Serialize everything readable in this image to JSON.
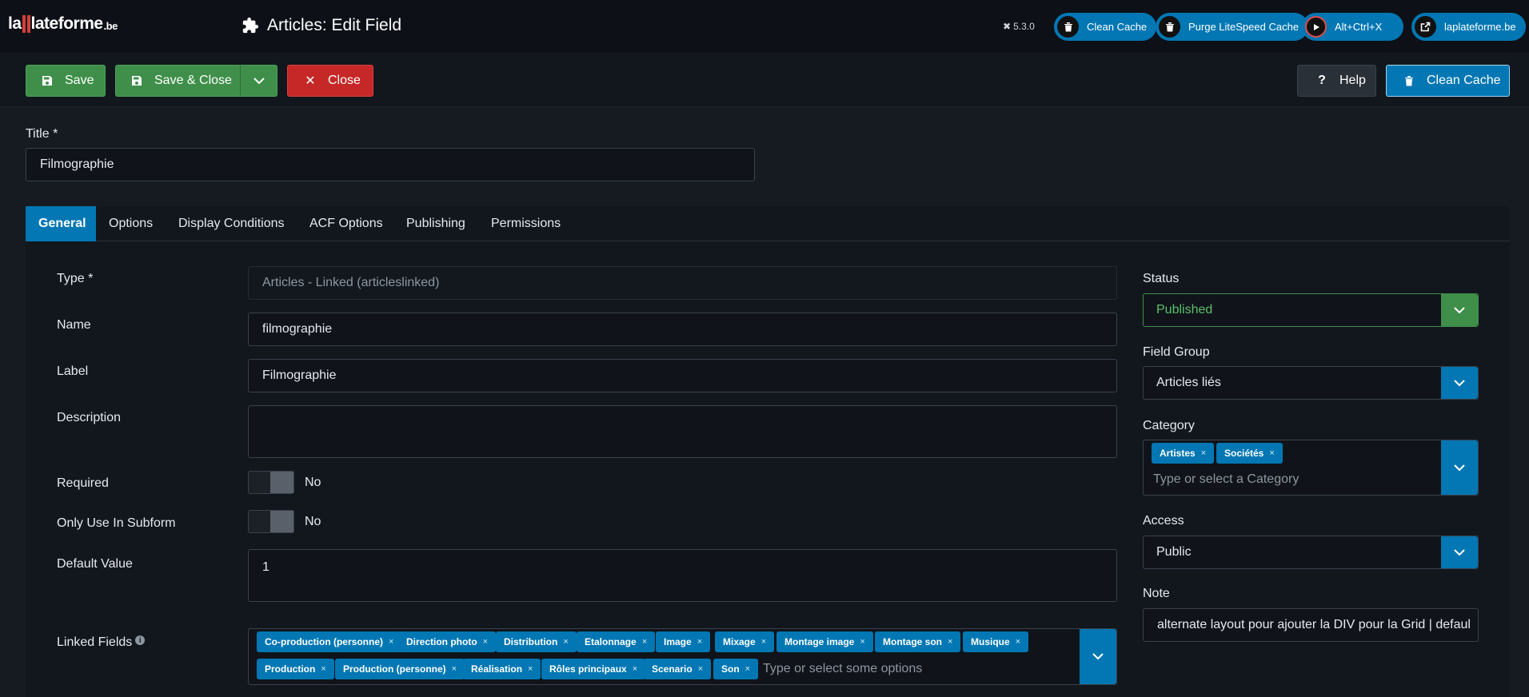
{
  "header": {
    "logo": {
      "la": "la",
      "word": "lateforme",
      "tld": ".be"
    },
    "page_title": "Articles: Edit Field",
    "version": "5.3.0",
    "pills": [
      {
        "label": "Clean Cache",
        "icon": "trash-icon"
      },
      {
        "label": "Purge LiteSpeed Cache",
        "icon": "trash-icon"
      },
      {
        "label": "Alt+Ctrl+X",
        "icon": "play-icon"
      },
      {
        "label": "laplateforme.be",
        "icon": "external-link-icon"
      }
    ]
  },
  "toolbar": {
    "save": "Save",
    "save_close": "Save & Close",
    "close": "Close",
    "help": "Help",
    "clean_cache": "Clean Cache"
  },
  "title_field": {
    "label": "Title *",
    "value": "Filmographie"
  },
  "tabs": [
    "General",
    "Options",
    "Display Conditions",
    "ACF Options",
    "Publishing",
    "Permissions"
  ],
  "general": {
    "type": {
      "label": "Type *",
      "value": "Articles - Linked (articleslinked)"
    },
    "name": {
      "label": "Name",
      "value": "filmographie"
    },
    "field_label": {
      "label": "Label",
      "value": "Filmographie"
    },
    "description": {
      "label": "Description",
      "value": ""
    },
    "required": {
      "label": "Required",
      "value": "No"
    },
    "only_subform": {
      "label": "Only Use In Subform",
      "value": "No"
    },
    "default_value": {
      "label": "Default Value",
      "value": "1"
    },
    "linked_fields": {
      "label": "Linked Fields",
      "tags": [
        "Co-production (personne)",
        "Direction photo",
        "Distribution",
        "Etalonnage",
        "Image",
        "Mixage",
        "Montage image",
        "Montage son",
        "Musique",
        "Production",
        "Production (personne)",
        "Réalisation",
        "Rôles principaux",
        "Scenario",
        "Son"
      ],
      "placeholder": "Type or select some options"
    }
  },
  "sidebar": {
    "status": {
      "label": "Status",
      "value": "Published"
    },
    "field_group": {
      "label": "Field Group",
      "value": "Articles liés"
    },
    "category": {
      "label": "Category",
      "tags": [
        "Artistes",
        "Sociétés"
      ],
      "placeholder": "Type or select a Category"
    },
    "access": {
      "label": "Access",
      "value": "Public"
    },
    "note": {
      "label": "Note",
      "value": "alternate layout pour ajouter la DIV pour la Grid | defaul"
    }
  },
  "colors": {
    "accent": "#0277b3",
    "success": "#3f8f4a",
    "danger": "#c52827",
    "background": "#161b22"
  }
}
